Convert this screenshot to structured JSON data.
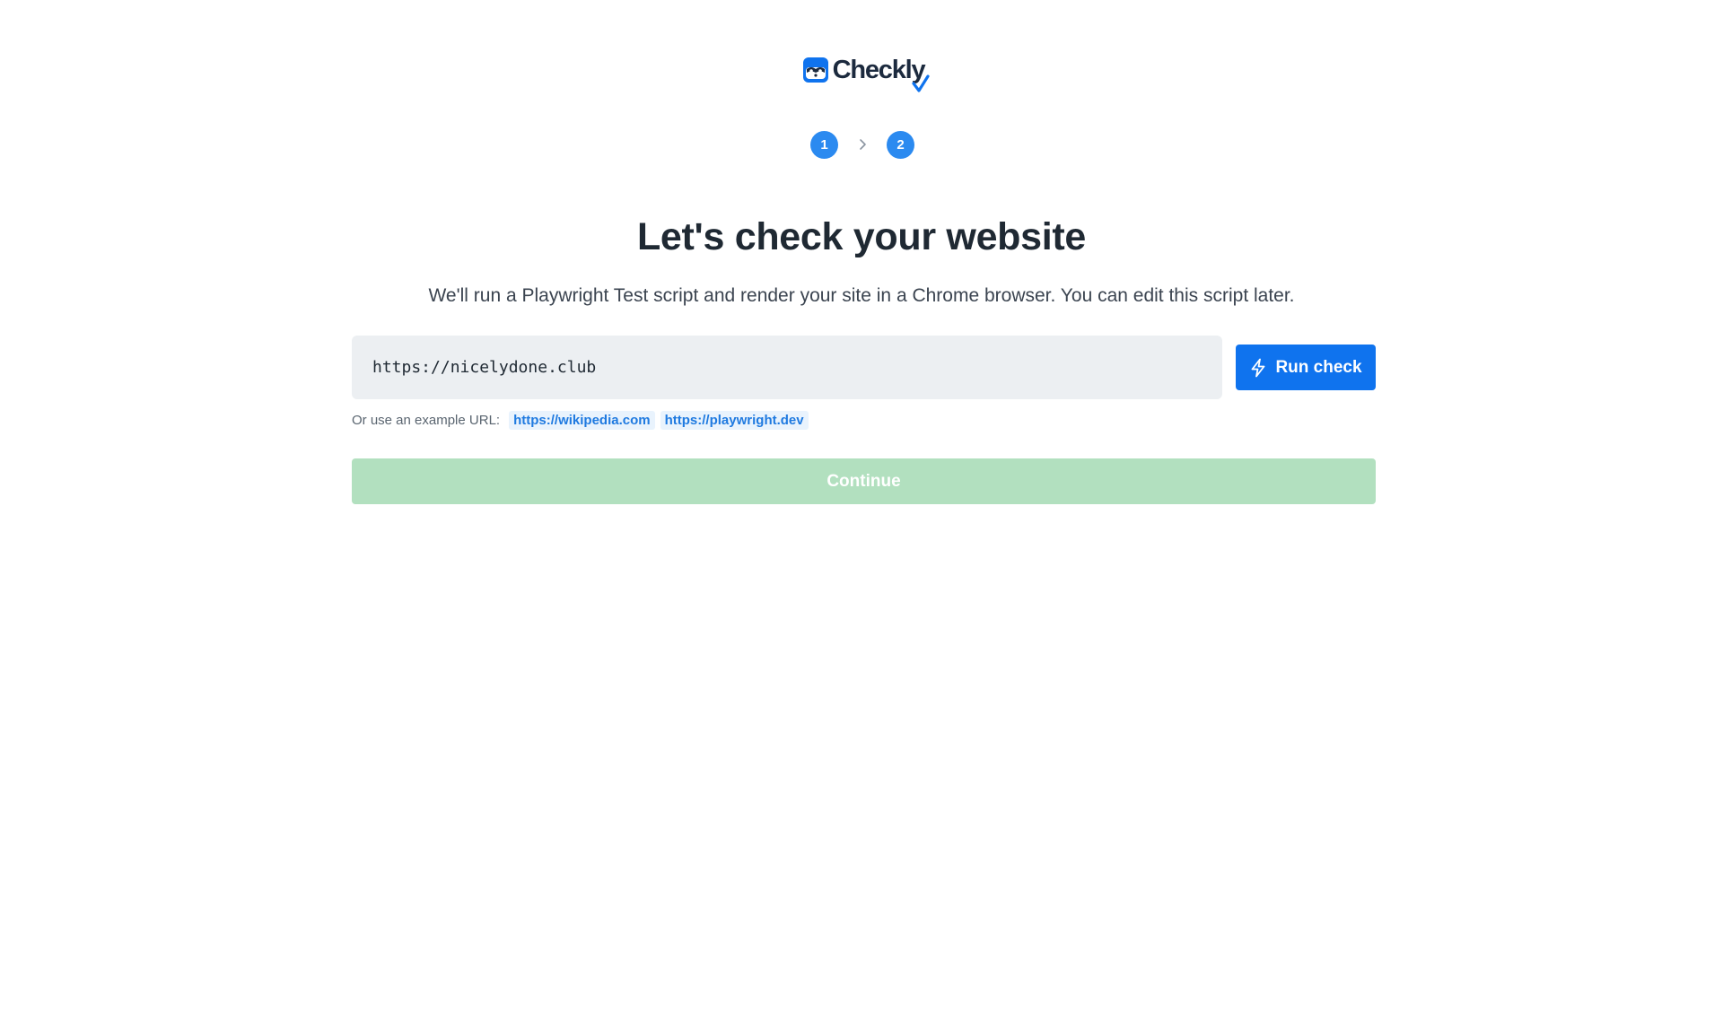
{
  "app": {
    "logo_text": "Checkly"
  },
  "steps": [
    {
      "number": "1"
    },
    {
      "number": "2"
    }
  ],
  "heading": {
    "title": "Let's check your website",
    "subtitle": "We'll run a Playwright Test script and render your site in a Chrome browser. You can edit this script later."
  },
  "url_form": {
    "value": "https://nicelydone.club",
    "run_label": "Run check"
  },
  "examples": {
    "label": "Or use an example URL:",
    "links": [
      "https://wikipedia.com",
      "https://playwright.dev"
    ]
  },
  "continue": {
    "label": "Continue",
    "disabled": true
  },
  "colors": {
    "brand_blue": "#0f73ee",
    "step_blue": "#2b8af0",
    "continue_disabled_green": "#b2e0bf",
    "input_bg": "#eceff2",
    "link_blue": "#1f7ae0"
  },
  "icons": {
    "logo": "checkly-raccoon-logo",
    "step_separator": "chevron-right-icon",
    "run_button": "lightning-bolt-icon"
  }
}
